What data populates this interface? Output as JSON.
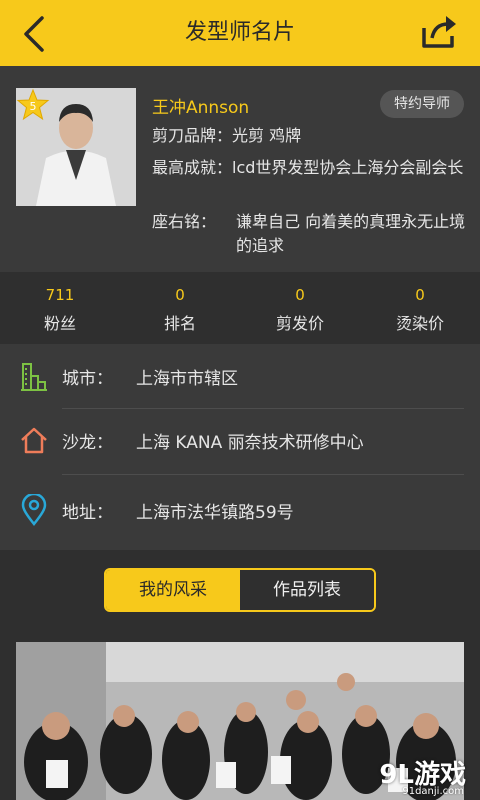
{
  "header": {
    "title": "发型师名片",
    "back_icon": "chevron-left-icon",
    "share_icon": "share-icon"
  },
  "profile": {
    "level": "5",
    "name": "王冲Annson",
    "role_tag": "特约导师",
    "rows": [
      {
        "label": "剪刀品牌：",
        "value": "光剪 鸡牌"
      },
      {
        "label": "最高成就：",
        "value": "lcd世界发型协会上海分会副会长"
      },
      {
        "label": "座右铭：",
        "value": "谦卑自己 向着美的真理永无止境的追求"
      }
    ]
  },
  "stats": [
    {
      "value": "711",
      "label": "粉丝"
    },
    {
      "value": "0",
      "label": "排名"
    },
    {
      "value": "0",
      "label": "剪发价"
    },
    {
      "value": "0",
      "label": "烫染价"
    }
  ],
  "details": [
    {
      "icon": "building-icon",
      "label": "城市：",
      "value": "上海市市辖区"
    },
    {
      "icon": "home-icon",
      "label": "沙龙：",
      "value": "上海 KANA 丽奈技术研修中心"
    },
    {
      "icon": "location-pin-icon",
      "label": "地址：",
      "value": "上海市法华镇路59号"
    }
  ],
  "tabs": {
    "active": "我的风采",
    "inactive": "作品列表"
  },
  "watermark": {
    "main": "9L游戏",
    "sub": "91danji.com"
  },
  "colors": {
    "accent": "#f7c91b",
    "background": "#2f2f2f",
    "panel": "#3a3a3a"
  }
}
